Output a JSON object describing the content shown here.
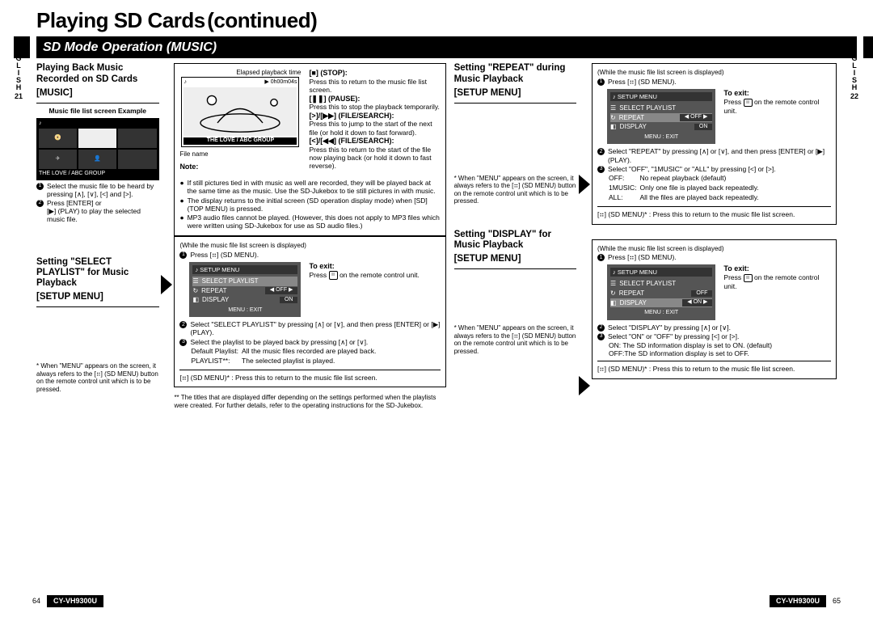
{
  "sidebar": {
    "lang": "ENGLISH",
    "page_left": "21",
    "page_right": "22"
  },
  "title": {
    "main": "Playing SD Cards",
    "cont": "(continued)"
  },
  "section_bar": "SD Mode Operation (MUSIC)",
  "col1": {
    "h1": "Playing Back Music Recorded on SD Cards",
    "h1b": "[MUSIC]",
    "example_label": "Music file list screen Example",
    "thumb_caption": "THE LOVE / ABC GROUP",
    "step1": "Select the music file to be heard by pressing [∧], [∨], [<] and [>].",
    "step2a": "Press [ENTER] or",
    "step2b": "[▶] (PLAY) to play the selected music file.",
    "h2": "Setting \"SELECT PLAYLIST\" for Music Playback",
    "h2b": "[SETUP MENU]",
    "note": "* When \"MENU\" appears on the screen, it always refers to the [⠶] (SD MENU) button on the remote control unit which is to be pressed."
  },
  "col2": {
    "elapsed_label": "Elapsed playback time",
    "screen_time": "0h00m04s",
    "screen_title": "THE LOVE / ABC GROUP",
    "filename_label": "File name",
    "stop_h": "[■] (STOP):",
    "stop_t": "Press this to return to the music file list screen.",
    "pause_h": "[❚❚] (PAUSE):",
    "pause_t": "Press this to stop the playback temporarily.",
    "fwd_h": "[>]/[▶▶] (FILE/SEARCH):",
    "fwd_t": "Press this to jump to the start of the next file (or hold it down to fast forward).",
    "back_h": "[<]/[◀◀] (FILE/SEARCH):",
    "back_t": "Press this to return to the start of the file now playing back (or hold it down to fast reverse).",
    "note_h": "Note:",
    "note1": "If still pictures tied in with music as well are recorded, they will be played back at the same time as the music. Use the SD-Jukebox to tie still pictures in with music.",
    "note2": "The display returns to the initial screen (SD operation display mode) when [SD] (TOP MENU) is pressed.",
    "note3": "MP3 audio files cannot be played. (However, this does not apply to MP3 files which were written using SD-Jukebox for use as SD audio files.)",
    "pl_intro": "(While the music file list screen is displayed)",
    "pl_s1": "Press [⠶] (SD MENU).",
    "menu_title": "SETUP MENU",
    "menu_i1": "SELECT PLAYLIST",
    "menu_i2": "REPEAT",
    "menu_i2v": "OFF",
    "menu_i3": "DISPLAY",
    "menu_i3v": "ON",
    "menu_exit": "MENU : EXIT",
    "toexit_h": "To exit:",
    "toexit_t1": "Press",
    "toexit_t2": "on the remote control unit.",
    "pl_s2": "Select \"SELECT PLAYLIST\" by pressing [∧] or [∨], and then press [ENTER] or [▶] (PLAY).",
    "pl_s3": "Select the playlist to be played back by pressing [∧] or [∨].",
    "pl_def1a": "Default Playlist:",
    "pl_def1b": "All the music files recorded are played back.",
    "pl_def2a": "PLAYLIST**:",
    "pl_def2b": "The selected playlist is played.",
    "pl_return": "[⠶] (SD MENU)* : Press this to return to the music file list screen.",
    "pl_foot": "** The titles that are displayed differ depending on the settings performed when the playlists were created. For further details, refer to the operating instructions for the SD-Jukebox."
  },
  "col3": {
    "h1": "Setting \"REPEAT\" during Music Playback",
    "h1b": "[SETUP MENU]",
    "note": "* When \"MENU\" appears on the screen, it always refers to the [⠶] (SD MENU) button on the remote control unit which is to be pressed.",
    "h2": "Setting \"DISPLAY\" for Music Playback",
    "h2b": "[SETUP MENU]"
  },
  "col4": {
    "intro": "(While the music file list screen is displayed)",
    "s1": "Press [⠶] (SD MENU).",
    "s2": "Select \"REPEAT\" by pressing [∧] or [∨], and then press [ENTER] or [▶] (PLAY).",
    "s3": "Select \"OFF\", \"1MUSIC\" or \"ALL\" by pressing [<] or [>].",
    "d_off_a": "OFF:",
    "d_off_b": "No repeat playback (default)",
    "d_1m_a": "1MUSIC:",
    "d_1m_b": "Only one file is played back repeatedly.",
    "d_all_a": "ALL:",
    "d_all_b": "All the files are played back repeatedly.",
    "ret": "[⠶] (SD MENU)* : Press this to return to the music file list screen.",
    "ds2": "Select \"DISPLAY\" by pressing [∧] or [∨].",
    "ds3": "Select \"ON\" or \"OFF\" by pressing [<] or [>].",
    "don": "ON: The SD information display is set to ON. (default)",
    "doff": "OFF:The SD information display is set to OFF."
  },
  "footer": {
    "pn_left": "64",
    "pn_right": "65",
    "model": "CY-VH9300U"
  }
}
